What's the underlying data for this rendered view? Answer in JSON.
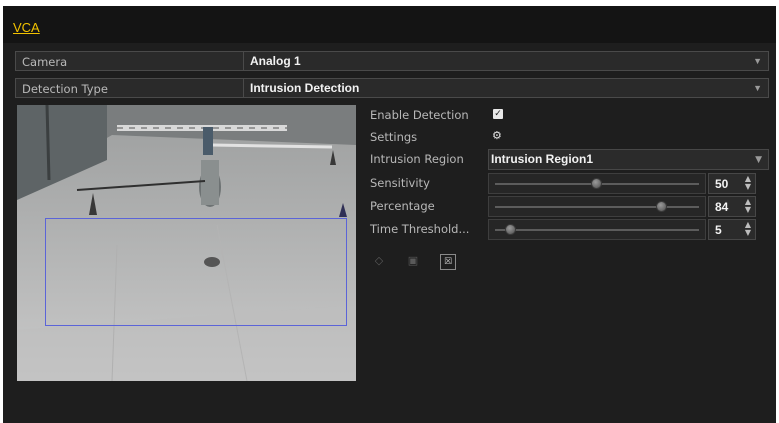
{
  "tab": {
    "label": "VCA"
  },
  "camera": {
    "label": "Camera",
    "value": "Analog 1"
  },
  "detection_type": {
    "label": "Detection Type",
    "value": "Intrusion Detection"
  },
  "panel": {
    "enable_detection": {
      "label": "Enable Detection",
      "checked": true
    },
    "settings": {
      "label": "Settings"
    },
    "intrusion_region": {
      "label": "Intrusion Region",
      "value": "Intrusion Region1"
    },
    "sensitivity": {
      "label": "Sensitivity",
      "value": "50",
      "level": 50
    },
    "percentage": {
      "label": "Percentage",
      "value": "84",
      "level": 84
    },
    "time_threshold": {
      "label": "Time Threshold...",
      "value": "5",
      "level": 5
    }
  },
  "toolbar": {
    "icons": [
      "draw-region-icon",
      "clear-region-icon",
      "clear-all-icon"
    ]
  },
  "colors": {
    "accent": "#f2c200",
    "region_border": "#5b64d8",
    "background": "#1e1e1e"
  }
}
